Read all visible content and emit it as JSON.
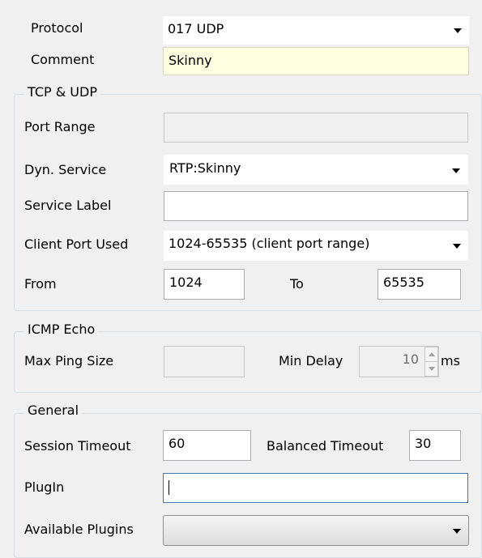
{
  "protocol": {
    "label": "Protocol",
    "value": "017 UDP"
  },
  "comment": {
    "label": "Comment",
    "value": "Skinny"
  },
  "tcp_udp": {
    "title": "TCP & UDP",
    "port_range": {
      "label": "Port Range",
      "value": ""
    },
    "dyn_service": {
      "label": "Dyn. Service",
      "value": "RTP:Skinny"
    },
    "service_label": {
      "label": "Service Label",
      "value": ""
    },
    "client_port_used": {
      "label": "Client Port Used",
      "value": "1024-65535 (client port range)"
    },
    "from": {
      "label": "From",
      "value": "1024"
    },
    "to": {
      "label": "To",
      "value": "65535"
    }
  },
  "icmp_echo": {
    "title": "ICMP Echo",
    "max_ping_size": {
      "label": "Max Ping Size",
      "value": ""
    },
    "min_delay": {
      "label": "Min Delay",
      "value": "10",
      "unit": "ms"
    }
  },
  "general": {
    "title": "General",
    "session_timeout": {
      "label": "Session Timeout",
      "value": "60"
    },
    "balanced_timeout": {
      "label": "Balanced Timeout",
      "value": "30"
    },
    "plugin": {
      "label": "PlugIn",
      "value": ""
    },
    "available_plugins": {
      "label": "Available Plugins",
      "value": ""
    }
  },
  "icons": {
    "dropdown": "chevron-down-icon",
    "spin_up": "spin-up-icon",
    "spin_down": "spin-down-icon"
  },
  "colors": {
    "window_bg": "#f0f0f0",
    "comment_bg": "#ffffe1",
    "group_border": "#d5dfe5",
    "focus_border": "#3d7bad"
  }
}
